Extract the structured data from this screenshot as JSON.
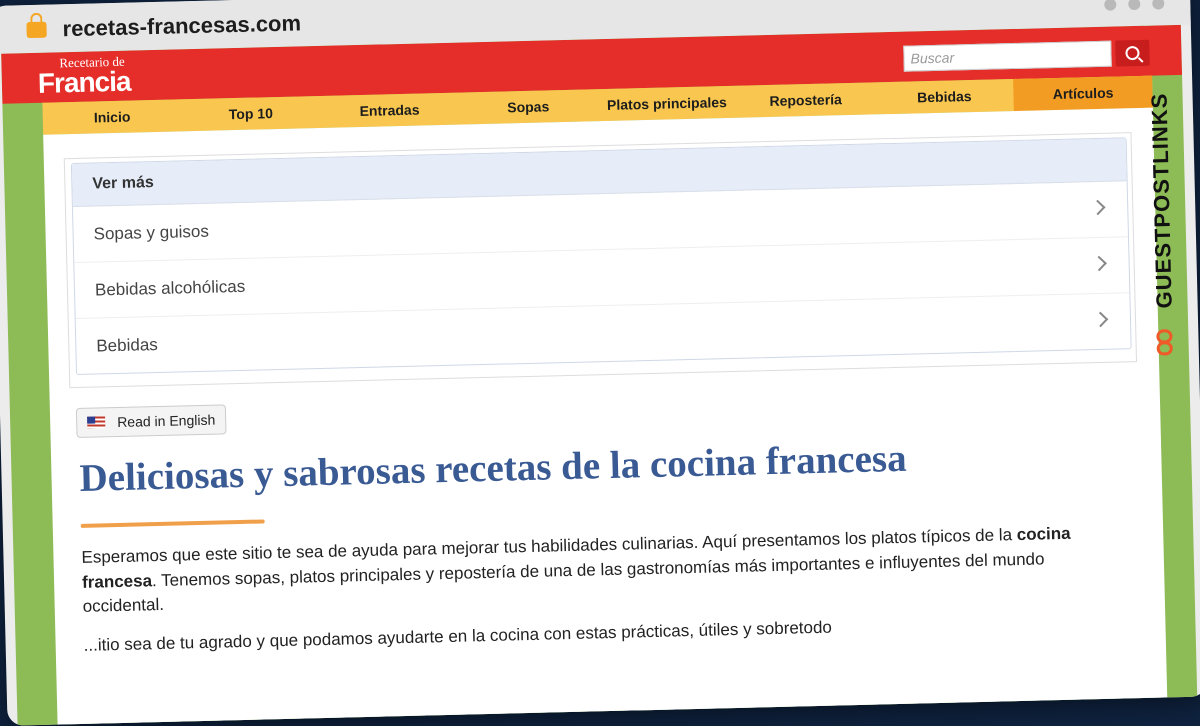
{
  "browser": {
    "url": "recetas-francesas.com"
  },
  "site": {
    "logo_small": "Recetario de",
    "logo_big": "Francia",
    "search_placeholder": "Buscar"
  },
  "nav": {
    "items": [
      {
        "label": "Inicio"
      },
      {
        "label": "Top 10"
      },
      {
        "label": "Entradas"
      },
      {
        "label": "Sopas"
      },
      {
        "label": "Platos principales"
      },
      {
        "label": "Repostería"
      },
      {
        "label": "Bebidas"
      },
      {
        "label": "Artículos"
      }
    ]
  },
  "vermas": {
    "heading": "Ver más",
    "items": [
      {
        "label": "Sopas y guisos"
      },
      {
        "label": "Bebidas alcohólicas"
      },
      {
        "label": "Bebidas"
      }
    ]
  },
  "lang_button": "Read in English",
  "main": {
    "title": "Deliciosas y sabrosas recetas de la cocina francesa",
    "para1_a": "Esperamos que este sitio te sea de ayuda para mejorar tus habilidades culinarias. Aquí presentamos los platos típicos de la ",
    "para1_b": "cocina francesa",
    "para1_c": ". Tenemos sopas, platos principales y repostería de una de las gastronomías más importantes e influyentes del mundo occidental.",
    "para2": "...itio sea de tu agrado y que podamos ayudarte en la cocina con estas prácticas, útiles y sobretodo"
  },
  "watermark": {
    "text": "GUESTPOSTLINKS"
  }
}
